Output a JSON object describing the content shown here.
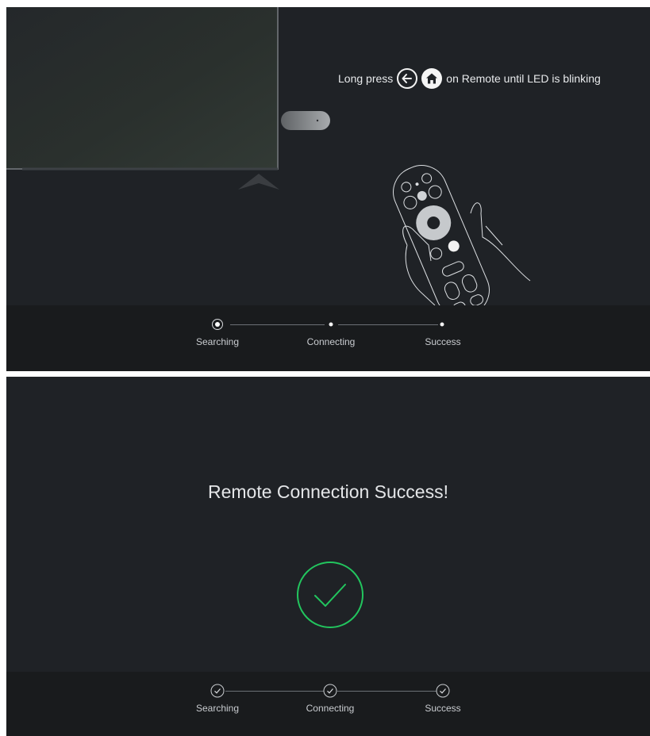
{
  "top_panel": {
    "instruction": {
      "prefix": "Long press",
      "back_icon": "back-arrow-icon",
      "home_icon": "home-icon",
      "suffix": "on Remote until LED is blinking"
    },
    "steps": [
      {
        "label": "Searching",
        "state": "active"
      },
      {
        "label": "Connecting",
        "state": "pending"
      },
      {
        "label": "Success",
        "state": "pending"
      }
    ]
  },
  "bottom_panel": {
    "title": "Remote Connection Success!",
    "status_icon": "check-circle-icon",
    "accent_color": "#22c55e",
    "steps": [
      {
        "label": "Searching",
        "state": "done"
      },
      {
        "label": "Connecting",
        "state": "done"
      },
      {
        "label": "Success",
        "state": "done"
      }
    ]
  }
}
